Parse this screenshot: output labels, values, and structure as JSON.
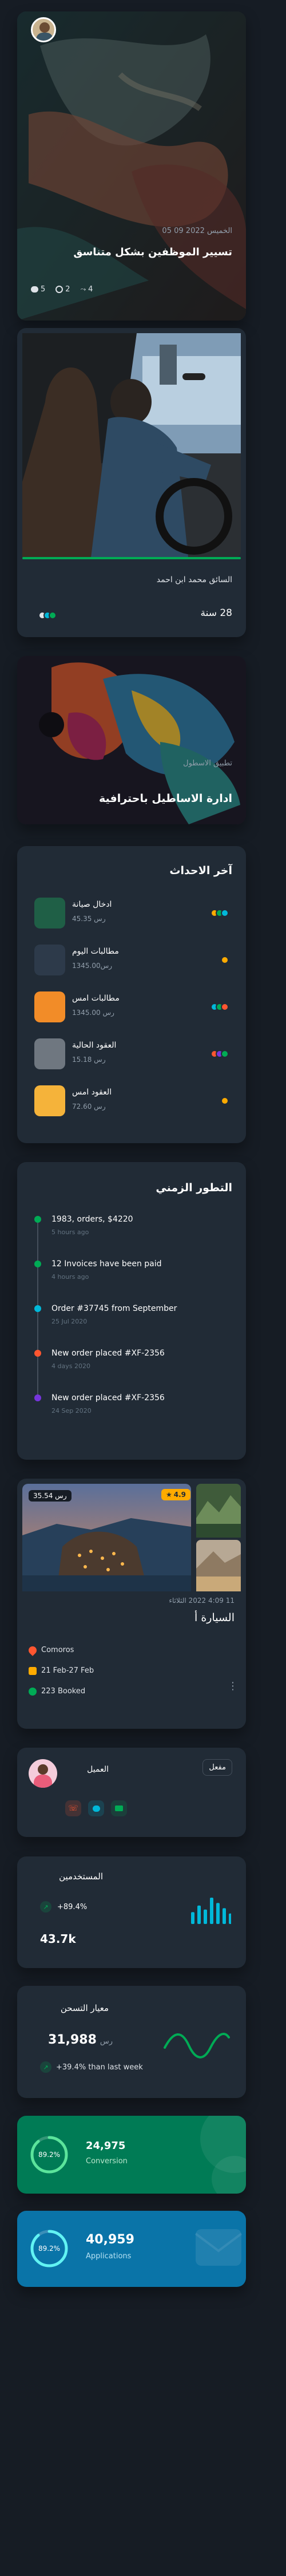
{
  "post_card": {
    "date": "الخميس 2022 09 05",
    "title": "تسيير الموظفين بشكل متناسق",
    "stats": [
      {
        "icon": "comment-icon",
        "value": "5"
      },
      {
        "icon": "eye-icon",
        "value": "2"
      },
      {
        "icon": "share-icon",
        "value": "4"
      }
    ]
  },
  "driver_card": {
    "name": "السائق محمد ابن احمد",
    "value": "28 سنة"
  },
  "fleet_card": {
    "subtitle": "تطبيق الاسطول",
    "title": "ادارة الاساطيل باحترافية"
  },
  "events": {
    "title": "آخر الاحداث",
    "items": [
      {
        "title": "ادخال صيانة",
        "amount": "رس 45.35",
        "colors": [
          "#ffab00",
          "#00ab55",
          "#00b8d9"
        ]
      },
      {
        "title": "مطالبات اليوم",
        "amount": "رس1345.00",
        "colors": [
          "#ffab00"
        ]
      },
      {
        "title": "مطالبات امس",
        "amount": "رس 1345.00",
        "colors": [
          "#00b8d9",
          "#00ab55",
          "#ff5630"
        ]
      },
      {
        "title": "العقود الحالية",
        "amount": "رس 15.18",
        "colors": [
          "#ff5630",
          "#7635dc",
          "#00ab55"
        ]
      },
      {
        "title": "العقود امس",
        "amount": "رس 72.60",
        "colors": [
          "#ffab00"
        ]
      }
    ]
  },
  "timeline": {
    "title": "التطور الزمني",
    "items": [
      {
        "text": "1983, orders, $4220",
        "time": "5 hours ago",
        "color": "#00ab55"
      },
      {
        "text": "12 Invoices have been paid",
        "time": "4 hours ago",
        "color": "#00ab55"
      },
      {
        "text": "Order #37745 from September",
        "time": "25 Jul 2020",
        "color": "#00b8d9"
      },
      {
        "text": "New order placed #XF-2356",
        "time": "4 days 2020",
        "color": "#ff5630"
      },
      {
        "text": "New order placed #XF-2356",
        "time": "24 Sep 2020",
        "color": "#7635dc"
      }
    ]
  },
  "car_card": {
    "price": "رس 35.54",
    "rating": "4.9",
    "date": "11 4:09 2022 الثلاثاء",
    "title": "السيارة أ",
    "location": "Comoros",
    "dates": "21 Feb-27 Feb",
    "booked": "223 Booked"
  },
  "client_card": {
    "label": "العميل",
    "status": "مفعل"
  },
  "users_card": {
    "title": "المستخدمين",
    "change": "+89.4%",
    "value": "43.7k",
    "bars": [
      0.45,
      0.7,
      0.55,
      1,
      0.8,
      0.6,
      0.4
    ]
  },
  "occupancy_card": {
    "title": "معيار التسحن",
    "value": "31,988",
    "currency": "رس",
    "trend": "+39.4% than last week"
  },
  "conversion_card": {
    "percent": "89.2%",
    "value": "24,975",
    "label": "Conversion",
    "fill": 0.89
  },
  "applications_card": {
    "percent": "89.2%",
    "value": "40,959",
    "label": "Applications",
    "fill": 0.89
  },
  "colors": {
    "green": "#00ab55",
    "orange": "#ffab00",
    "cyan": "#00b8d9",
    "red": "#ff5630",
    "purple": "#7635dc"
  }
}
